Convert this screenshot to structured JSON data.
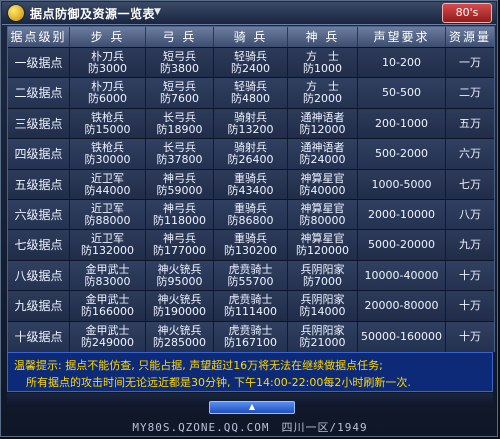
{
  "window": {
    "title": "据点防御及资源一览表",
    "badge": "80's"
  },
  "table": {
    "headers": [
      "据点级别",
      "步 兵",
      "弓 兵",
      "骑 兵",
      "神 兵",
      "声望要求",
      "资源量"
    ],
    "rows": [
      {
        "level": "一级据点",
        "infantry": [
          "朴刀兵",
          "防3000"
        ],
        "archer": [
          "短弓兵",
          "防3800"
        ],
        "cavalry": [
          "轻骑兵",
          "防2400"
        ],
        "divine": [
          "方　士",
          "防1000"
        ],
        "prestige": "10-200",
        "resource": "一万"
      },
      {
        "level": "二级据点",
        "infantry": [
          "朴刀兵",
          "防6000"
        ],
        "archer": [
          "短弓兵",
          "防7600"
        ],
        "cavalry": [
          "轻骑兵",
          "防4800"
        ],
        "divine": [
          "方　士",
          "防2000"
        ],
        "prestige": "50-500",
        "resource": "二万"
      },
      {
        "level": "三级据点",
        "infantry": [
          "铁枪兵",
          "防15000"
        ],
        "archer": [
          "长弓兵",
          "防18900"
        ],
        "cavalry": [
          "骑射兵",
          "防13200"
        ],
        "divine": [
          "通神语者",
          "防12000"
        ],
        "prestige": "200-1000",
        "resource": "五万"
      },
      {
        "level": "四级据点",
        "infantry": [
          "铁枪兵",
          "防30000"
        ],
        "archer": [
          "长弓兵",
          "防37800"
        ],
        "cavalry": [
          "骑射兵",
          "防26400"
        ],
        "divine": [
          "通神语者",
          "防24000"
        ],
        "prestige": "500-2000",
        "resource": "六万"
      },
      {
        "level": "五级据点",
        "infantry": [
          "近卫军",
          "防44000"
        ],
        "archer": [
          "神弓兵",
          "防59000"
        ],
        "cavalry": [
          "重骑兵",
          "防43400"
        ],
        "divine": [
          "神算星官",
          "防40000"
        ],
        "prestige": "1000-5000",
        "resource": "七万"
      },
      {
        "level": "六级据点",
        "infantry": [
          "近卫军",
          "防88000"
        ],
        "archer": [
          "神弓兵",
          "防118000"
        ],
        "cavalry": [
          "重骑兵",
          "防86800"
        ],
        "divine": [
          "神算星官",
          "防80000"
        ],
        "prestige": "2000-10000",
        "resource": "八万"
      },
      {
        "level": "七级据点",
        "infantry": [
          "近卫军",
          "防132000"
        ],
        "archer": [
          "神弓兵",
          "防177000"
        ],
        "cavalry": [
          "重骑兵",
          "防130200"
        ],
        "divine": [
          "神算星官",
          "防120000"
        ],
        "prestige": "5000-20000",
        "resource": "九万"
      },
      {
        "level": "八级据点",
        "infantry": [
          "金甲武士",
          "防83000"
        ],
        "archer": [
          "神火铳兵",
          "防95000"
        ],
        "cavalry": [
          "虎贲骑士",
          "防55700"
        ],
        "divine": [
          "兵阴阳家",
          "防7000"
        ],
        "prestige": "10000-40000",
        "resource": "十万"
      },
      {
        "level": "九级据点",
        "infantry": [
          "金甲武士",
          "防166000"
        ],
        "archer": [
          "神火铳兵",
          "防190000"
        ],
        "cavalry": [
          "虎贲骑士",
          "防111400"
        ],
        "divine": [
          "兵阴阳家",
          "防14000"
        ],
        "prestige": "20000-80000",
        "resource": "十万"
      },
      {
        "level": "十级据点",
        "infantry": [
          "金甲武士",
          "防249000"
        ],
        "archer": [
          "神火铳兵",
          "防285000"
        ],
        "cavalry": [
          "虎贲骑士",
          "防167100"
        ],
        "divine": [
          "兵阴阳家",
          "防21000"
        ],
        "prestige": "50000-160000",
        "resource": "十万"
      }
    ]
  },
  "notice": {
    "line1": "温馨提示: 据点不能仿查, 只能占据, 声望超过16万将无法在继续做据点任务;",
    "line2": "所有据点的攻击时间无论远近都是30分钟, 下午14:00-22:00每2小时刷新一次."
  },
  "footer": {
    "text": "MY80S.QZONE.QQ.COM　四川一区/1949"
  },
  "colors": {
    "header_bg": "#5a6b8f",
    "notice_bg": "#0d2a78",
    "notice_text": "#ffd700",
    "badge_bg": "#b42e2e"
  }
}
